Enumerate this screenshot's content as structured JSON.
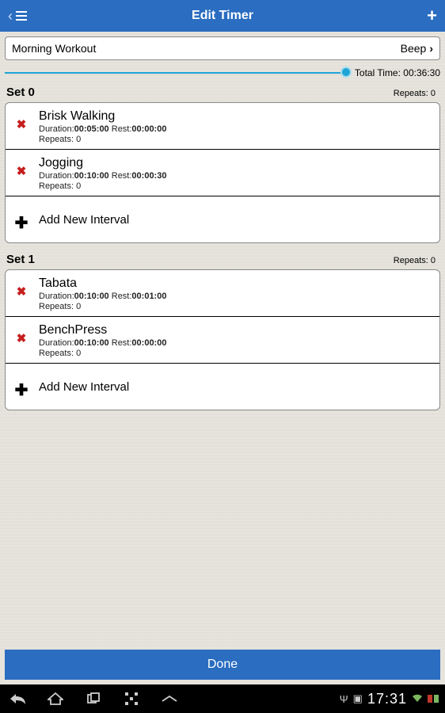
{
  "header": {
    "title": "Edit Timer"
  },
  "workout": {
    "name": "Morning Workout",
    "sound": "Beep"
  },
  "total_time_label": "Total Time: ",
  "total_time_value": "00:36:30",
  "duration_label": "Duration:",
  "rest_label": "Rest:",
  "repeats_label": "Repeats: ",
  "add_interval_label": "Add New Interval",
  "done_label": "Done",
  "sets": [
    {
      "title": "Set 0",
      "repeats_text": "Repeats: 0",
      "intervals": [
        {
          "name": "Brisk Walking",
          "duration": "00:05:00",
          "rest": "00:00:00",
          "repeats": "0"
        },
        {
          "name": "Jogging",
          "duration": "00:10:00",
          "rest": "00:00:30",
          "repeats": "0"
        }
      ]
    },
    {
      "title": "Set 1",
      "repeats_text": "Repeats: 0",
      "intervals": [
        {
          "name": "Tabata",
          "duration": "00:10:00",
          "rest": "00:01:00",
          "repeats": "0"
        },
        {
          "name": "BenchPress",
          "duration": "00:10:00",
          "rest": "00:00:00",
          "repeats": "0"
        }
      ]
    }
  ],
  "statusbar": {
    "time": "17:31"
  }
}
